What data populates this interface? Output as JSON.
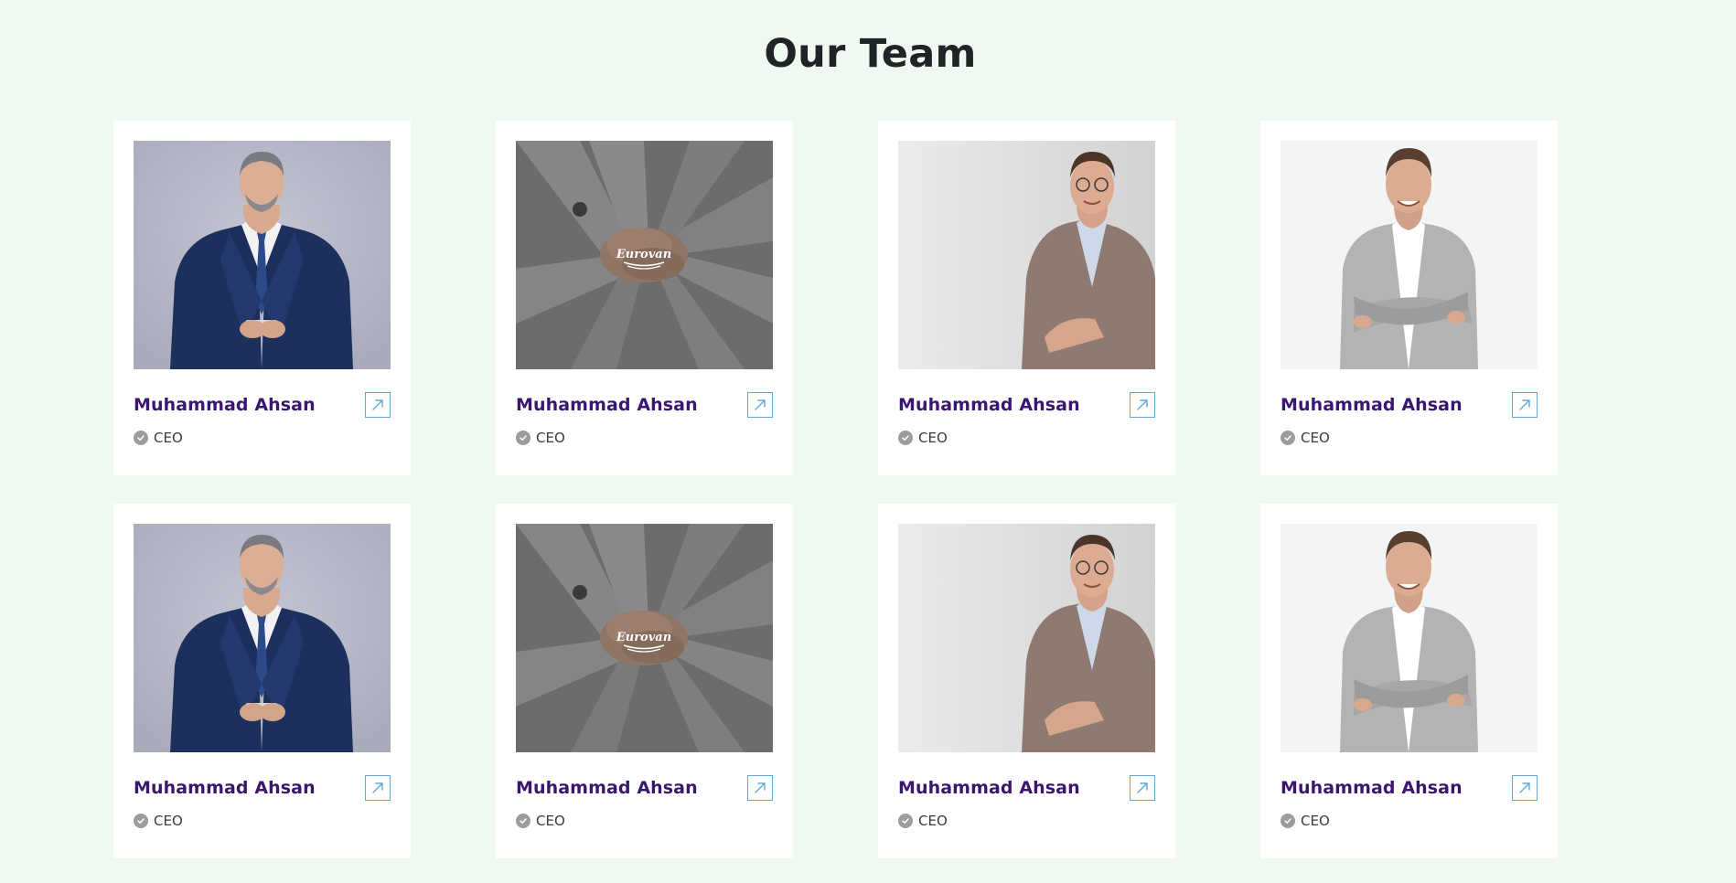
{
  "section": {
    "title": "Our Team"
  },
  "colors": {
    "page_background": "#eff9f2",
    "card_background": "#ffffff",
    "name_color": "#3b1670",
    "link_border": "#5fa9da",
    "check_badge": "#9c9c9c"
  },
  "icons": {
    "link": "arrow-up-right-icon",
    "role": "check-circle-icon"
  },
  "members": [
    {
      "name": "Muhammad Ahsan",
      "role": "CEO",
      "photo": "man-navy-suit-phone"
    },
    {
      "name": "Muhammad Ahsan",
      "role": "CEO",
      "photo": "stacked-hands-eurovan"
    },
    {
      "name": "Muhammad Ahsan",
      "role": "CEO",
      "photo": "man-glasses-checked-blazer"
    },
    {
      "name": "Muhammad Ahsan",
      "role": "CEO",
      "photo": "man-gray-blazer-arms-crossed"
    },
    {
      "name": "Muhammad Ahsan",
      "role": "CEO",
      "photo": "man-navy-suit-phone"
    },
    {
      "name": "Muhammad Ahsan",
      "role": "CEO",
      "photo": "stacked-hands-eurovan"
    },
    {
      "name": "Muhammad Ahsan",
      "role": "CEO",
      "photo": "man-glasses-checked-blazer"
    },
    {
      "name": "Muhammad Ahsan",
      "role": "CEO",
      "photo": "man-gray-blazer-arms-crossed"
    }
  ],
  "logo_text": "Eurovan"
}
